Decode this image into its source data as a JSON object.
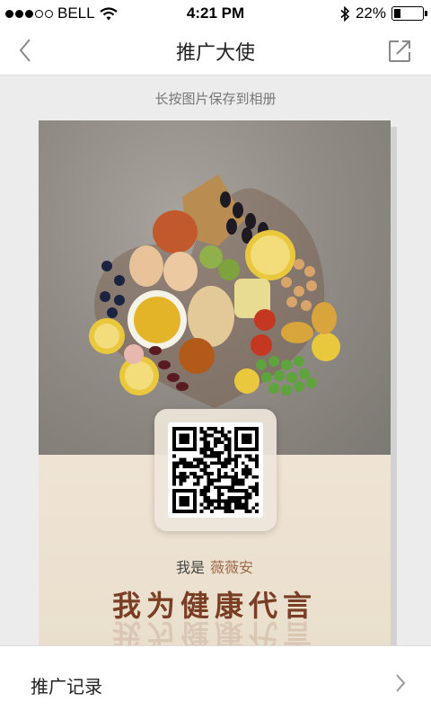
{
  "status_bar": {
    "carrier": "BELL",
    "time": "4:21 PM",
    "battery": "22%",
    "battery_level": 0.22,
    "signal_bars_filled": 3,
    "signal_bars_total": 5
  },
  "nav": {
    "title": "推广大使",
    "back_icon": "chevron-left-icon",
    "share_icon": "share-external-icon"
  },
  "hint": "长按图片保存到相册",
  "poster": {
    "intro_label": "我是",
    "ambassador_name": "薇薇安",
    "slogan": "我为健康代言"
  },
  "records_row": {
    "label": "推广记录",
    "arrow_icon": "chevron-right-icon"
  },
  "colors": {
    "accent_name": "#9c6b4a",
    "slogan": "#7a3e24",
    "poster_background": "#f1e6d6"
  }
}
